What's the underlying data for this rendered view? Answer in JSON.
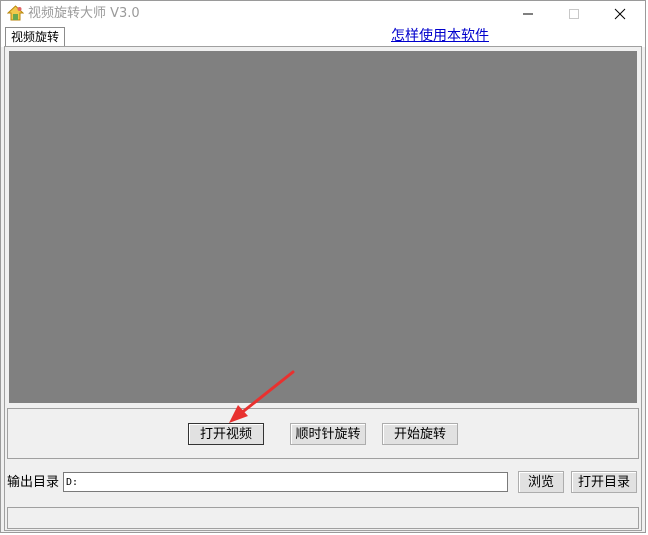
{
  "window": {
    "title": "视频旋转大师 V3.0"
  },
  "tabs": [
    {
      "label": "视频旋转"
    }
  ],
  "help_link": {
    "label": "怎样使用本软件"
  },
  "buttons": {
    "open_video": "打开视频",
    "rotate_clockwise": "顺时针旋转",
    "start_rotate": "开始旋转",
    "browse": "浏览",
    "open_directory": "打开目录"
  },
  "output": {
    "label": "输出目录",
    "value": "D:"
  },
  "colors": {
    "preview_background": "#808080",
    "link": "#0000cc",
    "annotation_arrow": "#e8312f"
  },
  "icons": {
    "app": "app-icon",
    "minimize": "minimize-icon",
    "maximize": "maximize-icon",
    "close": "close-icon"
  }
}
